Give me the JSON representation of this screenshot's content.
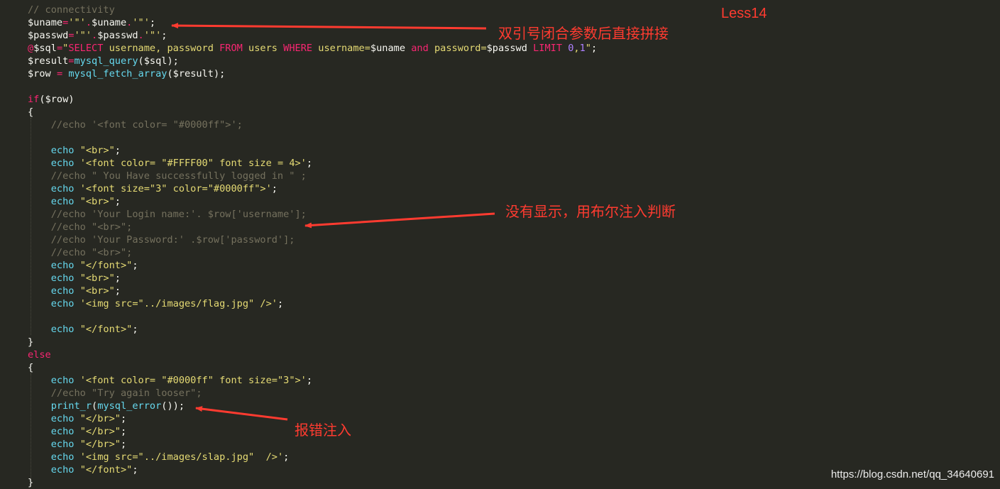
{
  "theme": {
    "background": "#272822",
    "default": "#f8f8f2",
    "variable": "#f8f8f2",
    "operator": "#f92672",
    "string": "#e6db74",
    "keyword": "#f92672",
    "function": "#66d9ef",
    "number": "#ae81ff",
    "comment": "#75715e",
    "annotation_color": "#ff3b30"
  },
  "code_lines": [
    [
      [
        "// connectivity",
        "comment"
      ]
    ],
    [
      [
        "$uname",
        "variable"
      ],
      [
        "=",
        "operator"
      ],
      [
        "'\"'",
        "string"
      ],
      [
        ".",
        "operator"
      ],
      [
        "$uname",
        "variable"
      ],
      [
        ".",
        "operator"
      ],
      [
        "'\"'",
        "string"
      ],
      [
        ";",
        "default"
      ]
    ],
    [
      [
        "$passwd",
        "variable"
      ],
      [
        "=",
        "operator"
      ],
      [
        "'\"'",
        "string"
      ],
      [
        ".",
        "operator"
      ],
      [
        "$passwd",
        "variable"
      ],
      [
        ".",
        "operator"
      ],
      [
        "'\"'",
        "string"
      ],
      [
        ";",
        "default"
      ]
    ],
    [
      [
        "@",
        "operator"
      ],
      [
        "$sql",
        "variable"
      ],
      [
        "=",
        "operator"
      ],
      [
        "\"",
        "string"
      ],
      [
        "SELECT",
        "keyword"
      ],
      [
        " username, password ",
        "string"
      ],
      [
        "FROM",
        "keyword"
      ],
      [
        " users ",
        "string"
      ],
      [
        "WHERE",
        "keyword"
      ],
      [
        " username=",
        "string"
      ],
      [
        "$uname",
        "variable"
      ],
      [
        " ",
        "string"
      ],
      [
        "and",
        "keyword"
      ],
      [
        " password=",
        "string"
      ],
      [
        "$passwd",
        "variable"
      ],
      [
        " ",
        "string"
      ],
      [
        "LIMIT",
        "keyword"
      ],
      [
        " ",
        "string"
      ],
      [
        "0",
        "number"
      ],
      [
        ",",
        "string"
      ],
      [
        "1",
        "number"
      ],
      [
        "\"",
        "string"
      ],
      [
        ";",
        "default"
      ]
    ],
    [
      [
        "$result",
        "variable"
      ],
      [
        "=",
        "operator"
      ],
      [
        "mysql_query",
        "function"
      ],
      [
        "(",
        "default"
      ],
      [
        "$sql",
        "variable"
      ],
      [
        ");",
        "default"
      ]
    ],
    [
      [
        "$row",
        "variable"
      ],
      [
        " ",
        "default"
      ],
      [
        "=",
        "operator"
      ],
      [
        " ",
        "default"
      ],
      [
        "mysql_fetch_array",
        "function"
      ],
      [
        "(",
        "default"
      ],
      [
        "$result",
        "variable"
      ],
      [
        ");",
        "default"
      ]
    ],
    [],
    [
      [
        "if",
        "keyword"
      ],
      [
        "(",
        "default"
      ],
      [
        "$row",
        "variable"
      ],
      [
        ")",
        "default"
      ]
    ],
    [
      [
        "{",
        "default"
      ]
    ],
    [
      [
        "    ",
        "default"
      ],
      [
        "//echo '<font color= \"#0000ff\">';",
        "comment"
      ]
    ],
    [],
    [
      [
        "    ",
        "default"
      ],
      [
        "echo",
        "function"
      ],
      [
        " ",
        "default"
      ],
      [
        "\"<br>\"",
        "string"
      ],
      [
        ";",
        "default"
      ]
    ],
    [
      [
        "    ",
        "default"
      ],
      [
        "echo",
        "function"
      ],
      [
        " ",
        "default"
      ],
      [
        "'<font color= \"#FFFF00\" font size = 4>'",
        "string"
      ],
      [
        ";",
        "default"
      ]
    ],
    [
      [
        "    ",
        "default"
      ],
      [
        "//echo \" You Have successfully logged in \" ;",
        "comment"
      ]
    ],
    [
      [
        "    ",
        "default"
      ],
      [
        "echo",
        "function"
      ],
      [
        " ",
        "default"
      ],
      [
        "'<font size=\"3\" color=\"#0000ff\">'",
        "string"
      ],
      [
        ";",
        "default"
      ]
    ],
    [
      [
        "    ",
        "default"
      ],
      [
        "echo",
        "function"
      ],
      [
        " ",
        "default"
      ],
      [
        "\"<br>\"",
        "string"
      ],
      [
        ";",
        "default"
      ]
    ],
    [
      [
        "    ",
        "default"
      ],
      [
        "//echo 'Your Login name:'. $row['username'];",
        "comment"
      ]
    ],
    [
      [
        "    ",
        "default"
      ],
      [
        "//echo \"<br>\";",
        "comment"
      ]
    ],
    [
      [
        "    ",
        "default"
      ],
      [
        "//echo 'Your Password:' .$row['password'];",
        "comment"
      ]
    ],
    [
      [
        "    ",
        "default"
      ],
      [
        "//echo \"<br>\";",
        "comment"
      ]
    ],
    [
      [
        "    ",
        "default"
      ],
      [
        "echo",
        "function"
      ],
      [
        " ",
        "default"
      ],
      [
        "\"</font>\"",
        "string"
      ],
      [
        ";",
        "default"
      ]
    ],
    [
      [
        "    ",
        "default"
      ],
      [
        "echo",
        "function"
      ],
      [
        " ",
        "default"
      ],
      [
        "\"<br>\"",
        "string"
      ],
      [
        ";",
        "default"
      ]
    ],
    [
      [
        "    ",
        "default"
      ],
      [
        "echo",
        "function"
      ],
      [
        " ",
        "default"
      ],
      [
        "\"<br>\"",
        "string"
      ],
      [
        ";",
        "default"
      ]
    ],
    [
      [
        "    ",
        "default"
      ],
      [
        "echo",
        "function"
      ],
      [
        " ",
        "default"
      ],
      [
        "'<img src=\"../images/flag.jpg\" />'",
        "string"
      ],
      [
        ";",
        "default"
      ]
    ],
    [],
    [
      [
        "    ",
        "default"
      ],
      [
        "echo",
        "function"
      ],
      [
        " ",
        "default"
      ],
      [
        "\"</font>\"",
        "string"
      ],
      [
        ";",
        "default"
      ]
    ],
    [
      [
        "}",
        "default"
      ]
    ],
    [
      [
        "else",
        "keyword"
      ]
    ],
    [
      [
        "{",
        "default"
      ]
    ],
    [
      [
        "    ",
        "default"
      ],
      [
        "echo",
        "function"
      ],
      [
        " ",
        "default"
      ],
      [
        "'<font color= \"#0000ff\" font size=\"3\">'",
        "string"
      ],
      [
        ";",
        "default"
      ]
    ],
    [
      [
        "    ",
        "default"
      ],
      [
        "//echo \"Try again looser\";",
        "comment"
      ]
    ],
    [
      [
        "    ",
        "default"
      ],
      [
        "print_r",
        "function"
      ],
      [
        "(",
        "default"
      ],
      [
        "mysql_error",
        "function"
      ],
      [
        "());",
        "default"
      ]
    ],
    [
      [
        "    ",
        "default"
      ],
      [
        "echo",
        "function"
      ],
      [
        " ",
        "default"
      ],
      [
        "\"</br>\"",
        "string"
      ],
      [
        ";",
        "default"
      ]
    ],
    [
      [
        "    ",
        "default"
      ],
      [
        "echo",
        "function"
      ],
      [
        " ",
        "default"
      ],
      [
        "\"</br>\"",
        "string"
      ],
      [
        ";",
        "default"
      ]
    ],
    [
      [
        "    ",
        "default"
      ],
      [
        "echo",
        "function"
      ],
      [
        " ",
        "default"
      ],
      [
        "\"</br>\"",
        "string"
      ],
      [
        ";",
        "default"
      ]
    ],
    [
      [
        "    ",
        "default"
      ],
      [
        "echo",
        "function"
      ],
      [
        " ",
        "default"
      ],
      [
        "'<img src=\"../images/slap.jpg\"  />'",
        "string"
      ],
      [
        ";",
        "default"
      ]
    ],
    [
      [
        "    ",
        "default"
      ],
      [
        "echo",
        "function"
      ],
      [
        " ",
        "default"
      ],
      [
        "\"</font>\"",
        "string"
      ],
      [
        ";",
        "default"
      ]
    ],
    [
      [
        "}",
        "default"
      ]
    ]
  ],
  "annotations": {
    "tag": "Less14",
    "note_1": "双引号闭合参数后直接拼接",
    "note_2": "没有显示，用布尔注入判断",
    "note_3": "报错注入"
  },
  "watermark": "https://blog.csdn.net/qq_34640691"
}
